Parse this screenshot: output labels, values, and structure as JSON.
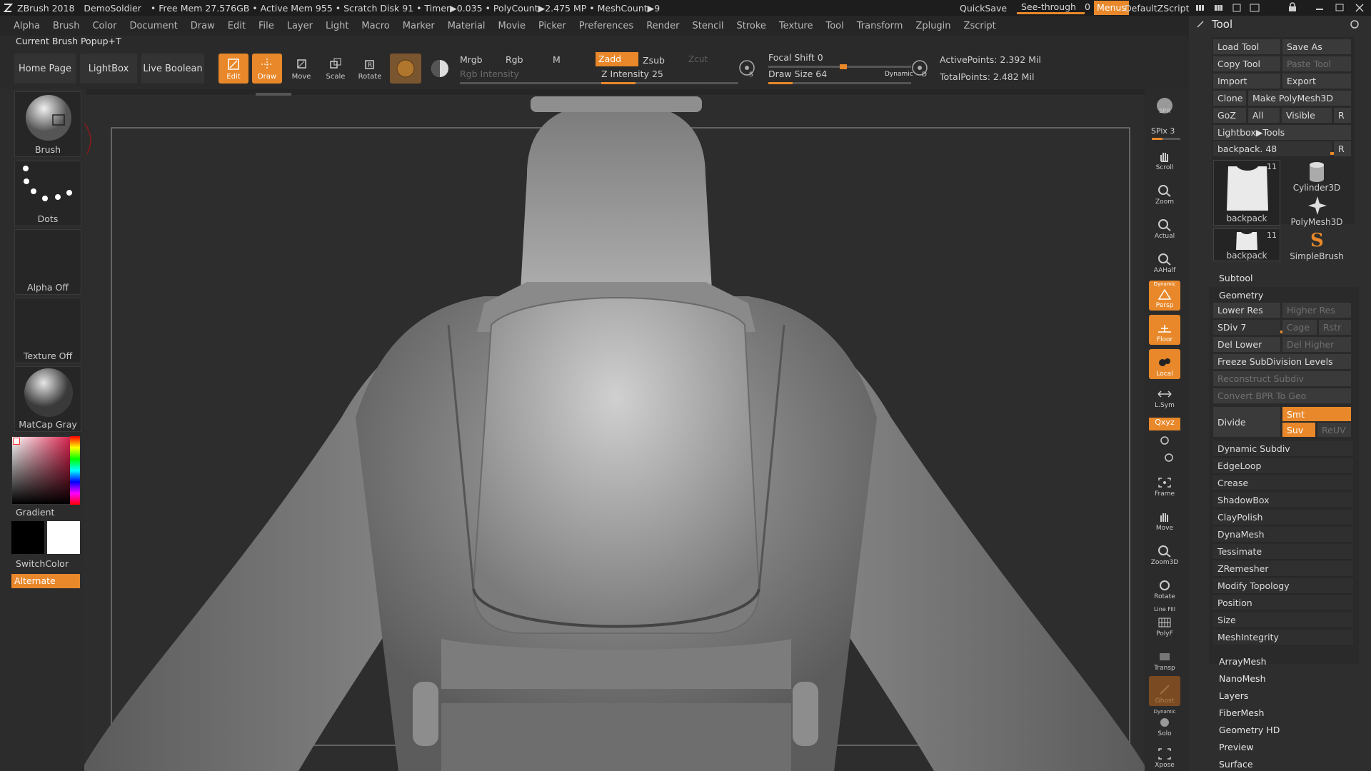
{
  "titlebar": {
    "items": [
      "ZBrush 2018",
      "DemoSoldier",
      "• Free Mem 27.576GB • Active Mem 955 • Scratch Disk 91 • Timer▶0.035 • PolyCount▶2.475 MP • MeshCount▶9"
    ],
    "quicksave": "QuickSave",
    "seethrough": "See-through",
    "seethrough_value": "0",
    "menus": "Menus",
    "zscript": "DefaultZScript"
  },
  "menubar": [
    "Alpha",
    "Brush",
    "Color",
    "Document",
    "Draw",
    "Edit",
    "File",
    "Layer",
    "Light",
    "Macro",
    "Marker",
    "Material",
    "Movie",
    "Picker",
    "Preferences",
    "Render",
    "Stencil",
    "Stroke",
    "Texture",
    "Tool",
    "Transform",
    "Zplugin",
    "Zscript"
  ],
  "popup_hint": "Current Brush Popup+T",
  "toolbar": {
    "home": "Home Page",
    "lightbox": "LightBox",
    "liveboolean": "Live Boolean",
    "edit": "Edit",
    "draw": "Draw",
    "move": "Move",
    "scale": "Scale",
    "rotate": "Rotate",
    "mrgb": "Mrgb",
    "rgb": "Rgb",
    "m": "M",
    "zadd": "Zadd",
    "zsub": "Zsub",
    "zcut": "Zcut",
    "rgb_intensity": "Rgb Intensity",
    "z_intensity_label": "Z Intensity",
    "z_intensity": "25",
    "focal_label": "Focal Shift",
    "focal": "0",
    "drawsize_label": "Draw Size",
    "drawsize": "64",
    "dynamic": "Dynamic",
    "activepoints": "ActivePoints: 2.392 Mil",
    "totalpoints": "TotalPoints: 2.482 Mil",
    "z_intensity_fraction": 0.25,
    "focal_fraction": 0.5,
    "drawsize_fraction": 0.17
  },
  "left": {
    "brush": "Brush",
    "dots": "Dots",
    "alpha": "Alpha Off",
    "texture": "Texture Off",
    "matcap": "MatCap Gray",
    "gradient": "Gradient",
    "switchcolor": "SwitchColor",
    "alternate": "Alternate"
  },
  "rightstrip": {
    "bpr": "BPR",
    "spix": "SPix 3",
    "scroll": "Scroll",
    "zoom": "Zoom",
    "actual": "Actual",
    "aahalf": "AAHalf",
    "persp": "Persp",
    "floor": "Floor",
    "local": "Local",
    "lsym": "L.Sym",
    "xyz": "Qxyz",
    "frame": "Frame",
    "move": "Move",
    "zoom3d": "Zoom3D",
    "rotate": "Rotate",
    "polyf": "PolyF",
    "linefill": "Line Fill",
    "transp": "Transp",
    "ghost": "Ghost",
    "solo": "Solo",
    "dynamic": "Dynamic",
    "xpose": "Xpose"
  },
  "toolpanel": {
    "title": "Tool",
    "load": "Load Tool",
    "saveas": "Save As",
    "copy": "Copy Tool",
    "paste": "Paste Tool",
    "import": "Import",
    "export": "Export",
    "clone": "Clone",
    "makepoly": "Make PolyMesh3D",
    "goz": "GoZ",
    "all": "All",
    "visible": "Visible",
    "r": "R",
    "lightboxtools": "Lightbox▶Tools",
    "current_tool": "backpack. 48",
    "thumbs": [
      {
        "label": "backpack",
        "count": "11"
      },
      {
        "label": "Cylinder3D",
        "count": ""
      },
      {
        "label": "PolyMesh3D",
        "count": ""
      },
      {
        "label": "backpack",
        "count": "11"
      },
      {
        "label": "SimpleBrush",
        "count": ""
      }
    ],
    "subtool": "Subtool",
    "geometry": "Geometry",
    "lowerres": "Lower Res",
    "higherres": "Higher Res",
    "sdiv": "SDiv 7",
    "cage": "Cage",
    "rstr": "Rstr",
    "dellower": "Del Lower",
    "delhigher": "Del Higher",
    "freeze": "Freeze SubDivision Levels",
    "reconstruct": "Reconstruct Subdiv",
    "convertbpr": "Convert BPR To Geo",
    "divide": "Divide",
    "smt": "Smt",
    "suv": "Suv",
    "reuv": "ReUV",
    "geo_items": [
      "Dynamic Subdiv",
      "EdgeLoop",
      "Crease",
      "ShadowBox",
      "ClayPolish",
      "DynaMesh",
      "Tessimate",
      "ZRemesher",
      "Modify Topology",
      "Position",
      "Size",
      "MeshIntegrity"
    ],
    "sections": [
      "ArrayMesh",
      "NanoMesh",
      "Layers",
      "FiberMesh",
      "Geometry HD",
      "Preview",
      "Surface"
    ]
  }
}
